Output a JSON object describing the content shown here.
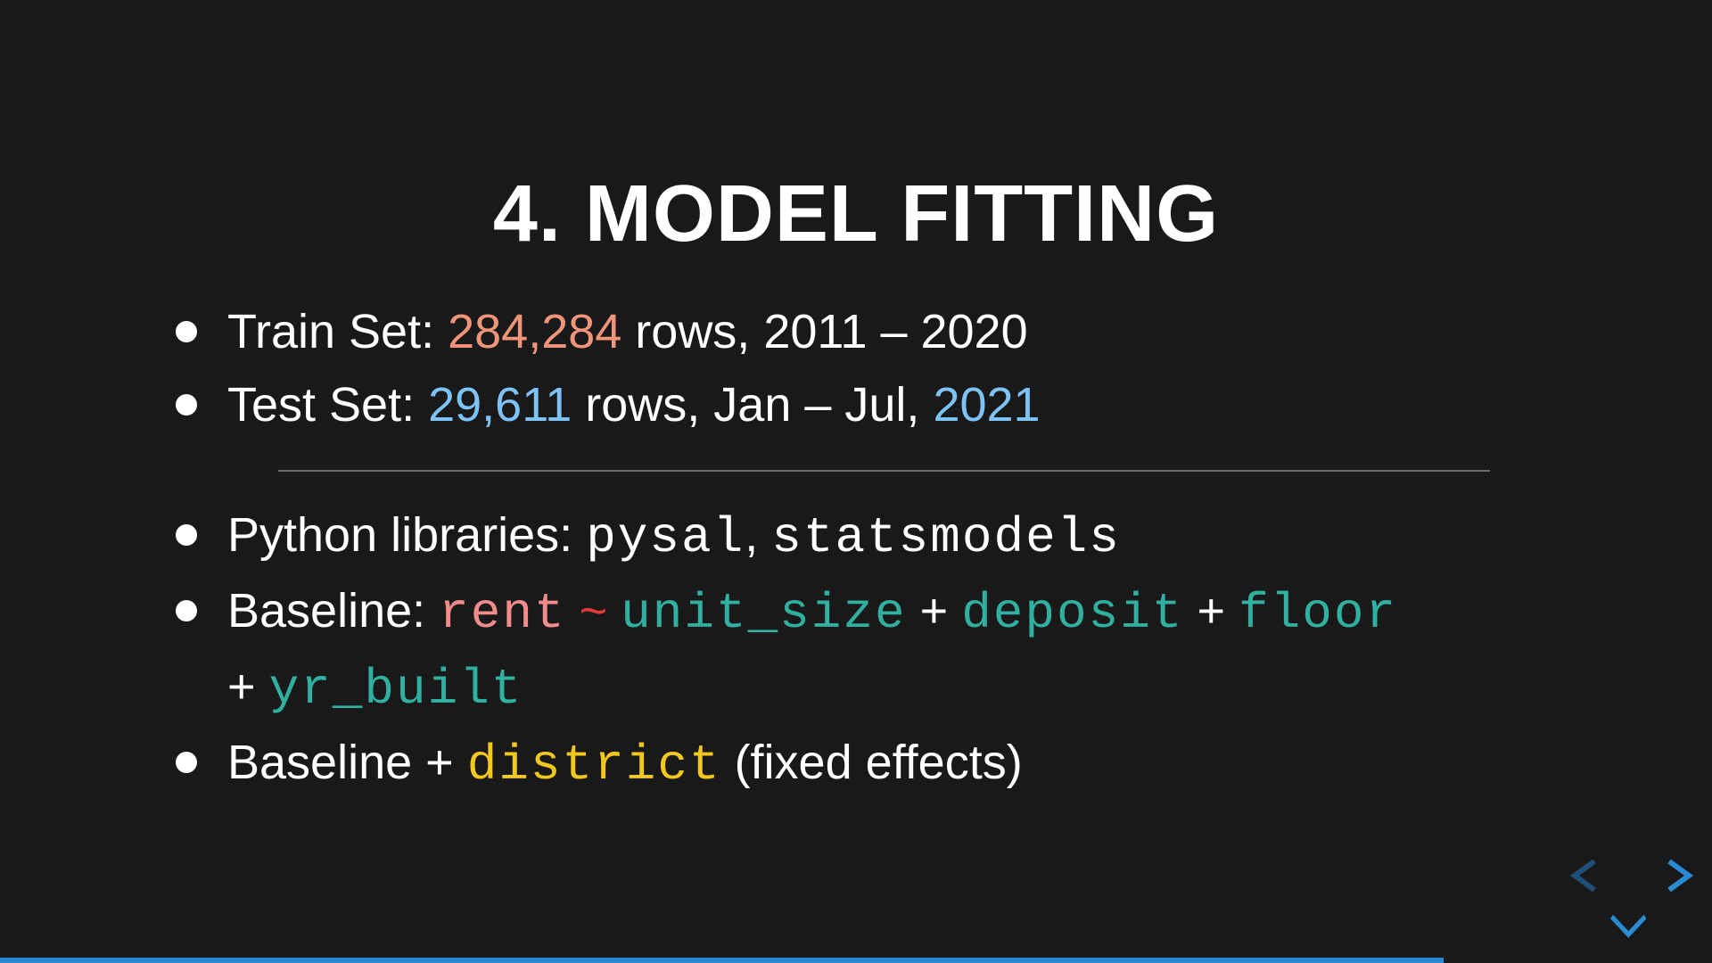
{
  "slide": {
    "title": "4. MODEL FITTING",
    "train": {
      "label": "Train Set: ",
      "count": "284,284",
      "rest": " rows, 2011 – 2020"
    },
    "test": {
      "label": "Test Set: ",
      "count": "29,611",
      "rest": " rows, Jan – Jul, ",
      "year": "2021"
    },
    "python": {
      "label": "Python libraries: ",
      "lib1": "pysal",
      "sep": ", ",
      "lib2": "statsmodels"
    },
    "baseline": {
      "label": "Baseline: ",
      "response": "rent",
      "tilde": "~",
      "terms": [
        "unit_size",
        "deposit",
        "floor",
        "yr_built"
      ],
      "plus": "+"
    },
    "fixed": {
      "label": "Baseline ",
      "plus": "+",
      "term": "district",
      "note": " (fixed effects)"
    }
  },
  "navigation": {
    "left_icon": "chevron-left-icon",
    "right_icon": "chevron-right-icon",
    "down_icon": "chevron-down-icon",
    "progress": 0.843
  },
  "colors": {
    "background": "#191919",
    "train_count": "#f0957a",
    "test_count": "#7ec3f5",
    "response": "#f28b8b",
    "tilde": "#e23a3a",
    "terms": "#2fb0a0",
    "district": "#f2c81d",
    "nav_active": "#2a8ad4",
    "nav_inactive": "#1f4f78"
  }
}
